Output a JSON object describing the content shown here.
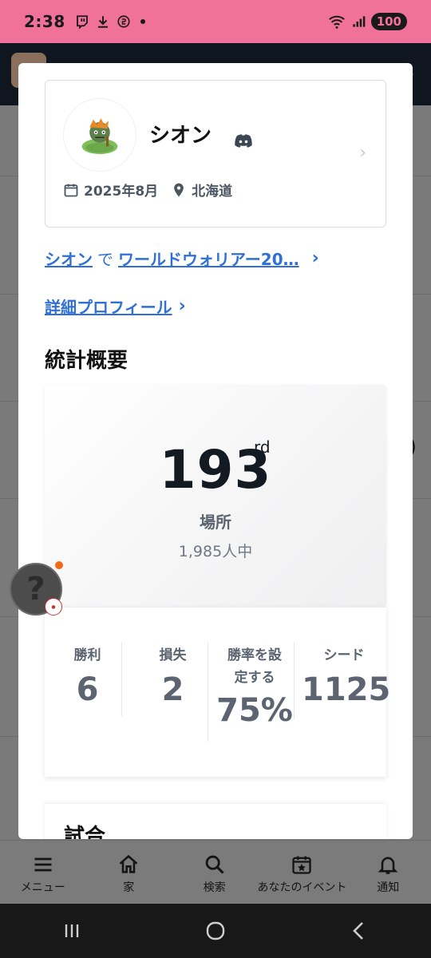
{
  "status_bar": {
    "time": "2:38",
    "battery": "100",
    "icons": [
      "twitch-icon",
      "download-icon",
      "sync-icon",
      "dot-icon",
      "wifi-icon",
      "signal-icon"
    ]
  },
  "profile": {
    "name": "シオン",
    "joined": "2025年8月",
    "location": "北海道",
    "avatar": "avatar-icon",
    "social": "discord-icon"
  },
  "event_link": {
    "player": "シオン",
    "connector": "で",
    "event": "ワールドウォリアー20…",
    "chevron": "›"
  },
  "detail_link": {
    "label": "詳細プロフィール",
    "chevron": "›"
  },
  "stats_section": {
    "title": "統計概要",
    "rank": "193",
    "rank_suffix": "rd",
    "rank_label": "場所",
    "rank_sub": "1,985人中",
    "items": [
      {
        "label": "勝利",
        "value": "6"
      },
      {
        "label": "損失",
        "value": "2"
      },
      {
        "label": "勝率を設定する",
        "value": "75%"
      },
      {
        "label": "シード",
        "value": "1125"
      }
    ]
  },
  "matches": {
    "title": "試合"
  },
  "bottom_nav": [
    {
      "label": "メニュー",
      "icon": "menu-icon"
    },
    {
      "label": "家",
      "icon": "home-icon"
    },
    {
      "label": "検索",
      "icon": "search-icon"
    },
    {
      "label": "あなたのイベント",
      "icon": "calendar-star-icon"
    },
    {
      "label": "通知",
      "icon": "bell-icon"
    }
  ],
  "help": {
    "symbol": "?"
  },
  "colors": {
    "status_bar": "#f0729a",
    "link": "#2f6fd6",
    "header_dark": "#0f1620",
    "accent_dot": "#f06a1a"
  }
}
